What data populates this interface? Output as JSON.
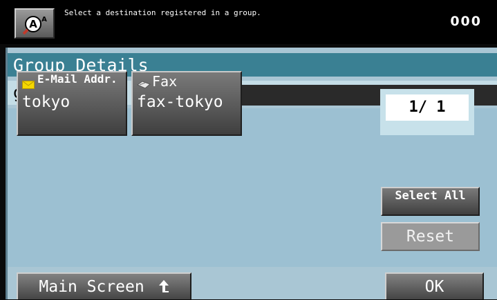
{
  "header": {
    "message": "Select a destination registered in a group.",
    "counter": "000",
    "help_icon": "help-accessibility-icon"
  },
  "panel": {
    "title": "Group Details",
    "group_name": "group"
  },
  "destinations": [
    {
      "type_label": "E-Mail Addr.",
      "type_icon": "envelope-icon",
      "name": "tokyo"
    },
    {
      "type_label": "Fax",
      "type_icon": "fax-icon",
      "name": "fax-tokyo"
    }
  ],
  "pagination": {
    "label": "1/ 1"
  },
  "buttons": {
    "select_all": "Select All",
    "reset": "Reset",
    "main_screen": "Main Screen",
    "ok": "OK"
  },
  "colors": {
    "title_bar": "#3a8093",
    "panel_bg": "#a9c6d4",
    "envelope": "#f5d800"
  }
}
